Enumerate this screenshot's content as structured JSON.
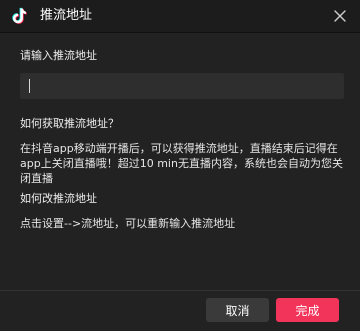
{
  "window": {
    "title": "推流地址"
  },
  "form": {
    "address_label": "请输入推流地址",
    "address_value": ""
  },
  "help": {
    "q1_title": "如何获取推流地址？",
    "q1_body": "在抖音app移动端开播后，可以获得推流地址，直播结束后记得在app上关闭直播哦！超过10 min无直播内容，系统也会自动为您关闭直播",
    "q2_title": "如何改推流地址",
    "q2_body": "点击设置-->流地址，可以重新输入推流地址"
  },
  "footer": {
    "cancel_label": "取消",
    "done_label": "完成"
  },
  "colors": {
    "accent": "#f2345a",
    "background": "#222222"
  },
  "icons": {
    "app": "tiktok-logo-icon",
    "close": "close-icon"
  }
}
